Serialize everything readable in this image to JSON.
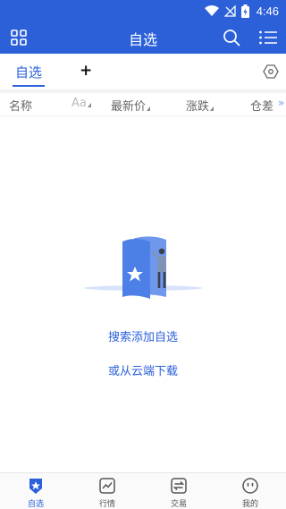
{
  "status_bar": {
    "time": "4:46"
  },
  "app_bar": {
    "title": "自选"
  },
  "tabs": {
    "active_label": "自选",
    "add_label": "+"
  },
  "columns": {
    "name": "名称",
    "aa": "Aa",
    "price": "最新价",
    "change": "涨跌",
    "diff": "仓差",
    "more": "»"
  },
  "empty_state": {
    "search_add": "搜索添加自选",
    "cloud_download": "或从云端下载"
  },
  "bottom_nav": [
    {
      "label": "自选",
      "icon": "star-shield-icon",
      "active": true
    },
    {
      "label": "行情",
      "icon": "chart-icon",
      "active": false
    },
    {
      "label": "交易",
      "icon": "swap-icon",
      "active": false
    },
    {
      "label": "我的",
      "icon": "face-icon",
      "active": false
    }
  ],
  "colors": {
    "primary": "#2b60d9",
    "status_bar": "#2b60d9",
    "link": "#2b60d9"
  }
}
